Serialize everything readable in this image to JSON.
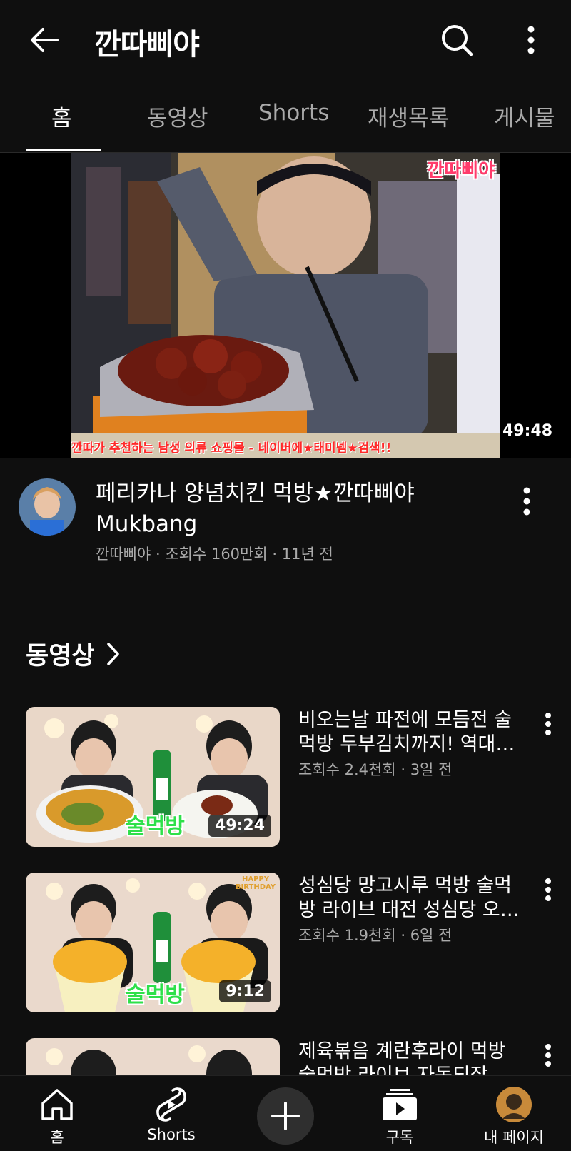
{
  "header": {
    "channel_name": "깐따삐야"
  },
  "tabs": [
    {
      "label": "홈",
      "active": true
    },
    {
      "label": "동영상",
      "active": false
    },
    {
      "label": "Shorts",
      "active": false
    },
    {
      "label": "재생목록",
      "active": false
    },
    {
      "label": "게시물",
      "active": false
    }
  ],
  "featured": {
    "title": "페리카나 양념치킨 먹방★깐따삐야 Mukbang",
    "duration": "49:48",
    "channel": "깐따삐야",
    "views": "조회수 160만회",
    "age": "11년 전",
    "thumb_watermark": "깐따삐야",
    "thumb_caption": "깐따가 추천하는 남성 의류 쇼핑몰 - 네이버에★태미넴★검색!!"
  },
  "videos_section": {
    "title": "동영상",
    "items": [
      {
        "title": "비오는날 파전에 모듬전 술먹방 두부김치까지! 역대급 조합",
        "meta": "조회수 2.4천회 · 3일 전",
        "duration": "49:24",
        "thumb_text": "술먹방"
      },
      {
        "title": "성심당 망고시루 먹방 술먹방 라이브 대전 성심당 오픈런 후기",
        "meta": "조회수 1.9천회 · 6일 전",
        "duration": "9:12",
        "thumb_text": "술먹방",
        "thumb_badge": "HAPPY BIRTHDAY"
      },
      {
        "title": "제육볶음 계란후라이 먹방 술먹방 라이브 자동되잖찌...",
        "meta": "",
        "duration": "",
        "thumb_text": ""
      }
    ]
  },
  "bottom_nav": {
    "home": "홈",
    "shorts": "Shorts",
    "subscriptions": "구독",
    "you": "내 페이지"
  },
  "icons": {
    "back": "back-arrow-icon",
    "search": "search-icon",
    "more": "more-vert-icon",
    "home": "home-icon",
    "shorts": "shorts-icon",
    "create": "plus-icon",
    "subscriptions": "subscriptions-icon"
  },
  "colors": {
    "background": "#0f0f0f",
    "text": "#f1f1f1",
    "secondary_text": "#aaaaaa"
  }
}
